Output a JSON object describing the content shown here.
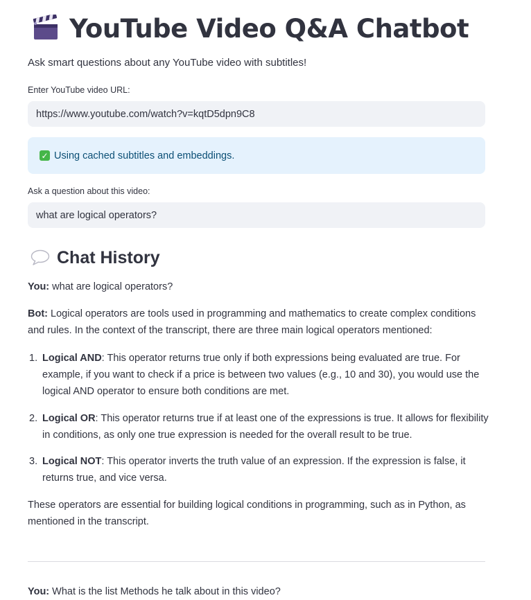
{
  "header": {
    "icon": "clapperboard-icon",
    "title": "YouTube Video Q&A Chatbot",
    "subtitle": "Ask smart questions about any YouTube video with subtitles!"
  },
  "url_field": {
    "label": "Enter YouTube video URL:",
    "value": "https://www.youtube.com/watch?v=kqtD5dpn9C8"
  },
  "status_alert": {
    "icon": "check-mark-button-icon",
    "text": "Using cached subtitles and embeddings."
  },
  "question_field": {
    "label": "Ask a question about this video:",
    "value": "what are logical operators?"
  },
  "chat": {
    "heading_icon": "speech-balloon-icon",
    "heading": "Chat History",
    "turn1": {
      "you_label": "You:",
      "question": " what are logical operators?",
      "bot_label": "Bot:",
      "intro": " Logical operators are tools used in programming and mathematics to create complex conditions and rules. In the context of the transcript, there are three main logical operators mentioned:",
      "items": [
        {
          "num": "1.",
          "term": "Logical AND",
          "text": ": This operator returns true only if both expressions being evaluated are true. For example, if you want to check if a price is between two values (e.g., 10 and 30), you would use the logical AND operator to ensure both conditions are met."
        },
        {
          "num": "2.",
          "term": "Logical OR",
          "text": ": This operator returns true if at least one of the expressions is true. It allows for flexibility in conditions, as only one true expression is needed for the overall result to be true."
        },
        {
          "num": "3.",
          "term": "Logical NOT",
          "text": ": This operator inverts the truth value of an expression. If the expression is false, it returns true, and vice versa."
        }
      ],
      "outro": "These operators are essential for building logical conditions in programming, such as in Python, as mentioned in the transcript."
    },
    "turn2": {
      "you_label": "You:",
      "question": " What is the list Methods he talk about in this video?"
    }
  },
  "colors": {
    "text": "#31333f",
    "input_bg": "#f0f2f6",
    "alert_bg": "#e5f2fd",
    "alert_text": "#0b4f75",
    "check_green": "#45b649",
    "divider": "#dadbe0"
  }
}
